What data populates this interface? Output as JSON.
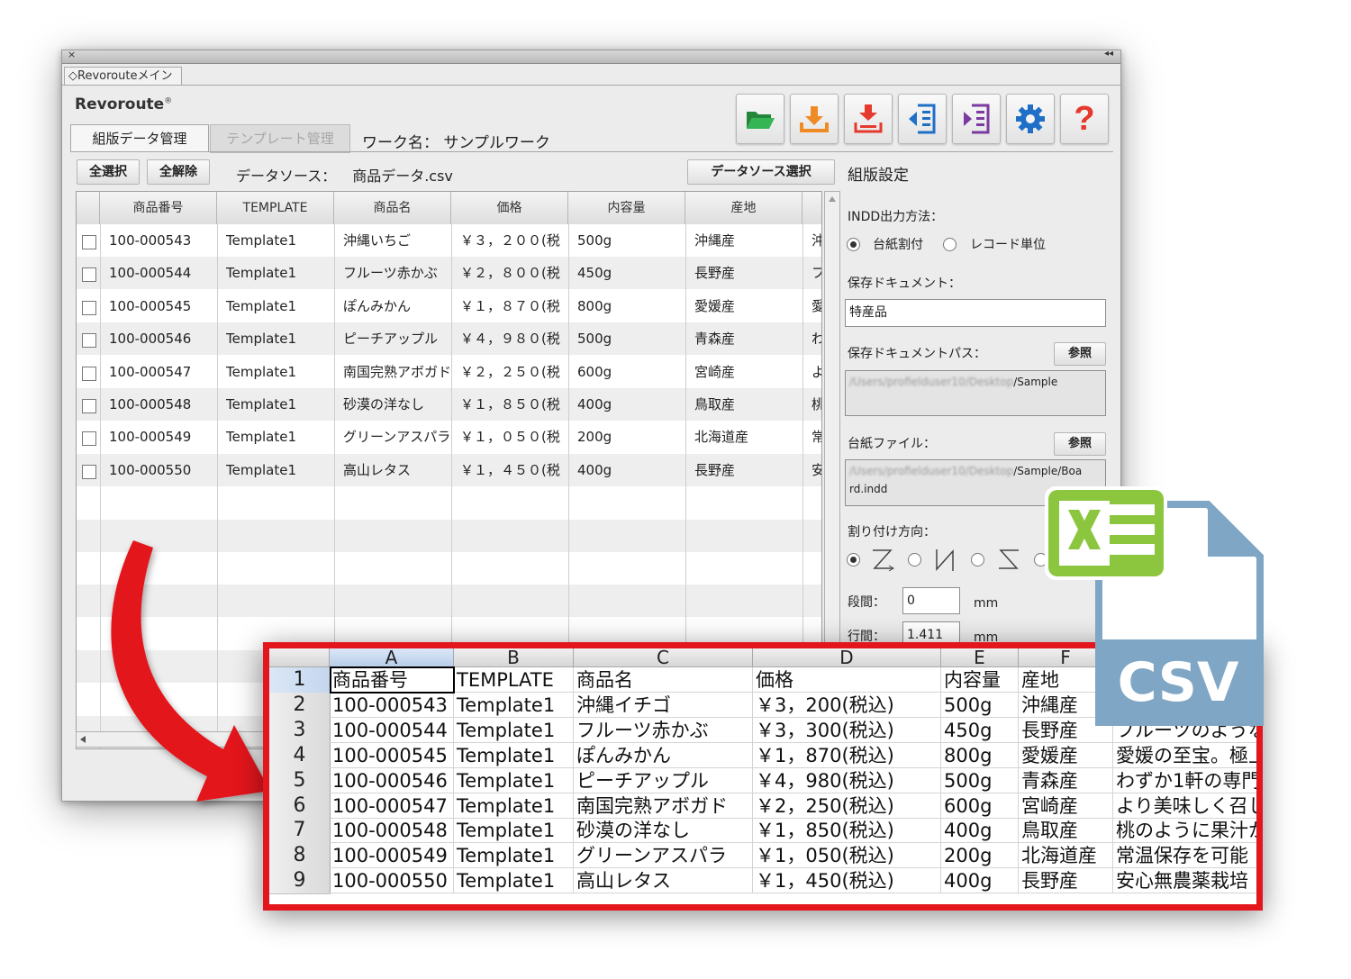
{
  "window": {
    "close_glyph": "×",
    "collapse_glyph": "◂◂",
    "panel_tab": "◇Revorouteメイン",
    "brand": "Revoroute",
    "brand_mark": "®"
  },
  "toolbar": {
    "icons": [
      "open-folder-icon",
      "import-icon",
      "export-icon",
      "indesign-export-icon",
      "indesign-import-icon",
      "gear-icon",
      "help-icon"
    ],
    "help_glyph": "?",
    "colors": {
      "green": "#2f9e44",
      "orange": "#f08a24",
      "blue": "#1f6fc7",
      "purple": "#7b3aa0",
      "red": "#e6392e"
    }
  },
  "tabs": {
    "active": "組版データ管理",
    "inactive": "テンプレート管理"
  },
  "workname": "ワーク名： サンプルワーク",
  "datasource": {
    "select_all": "全選択",
    "deselect_all": "全解除",
    "label": "データソース：",
    "value": "商品データ.csv",
    "select_button": "データソース選択"
  },
  "grid": {
    "columns": [
      "商品番号",
      "TEMPLATE",
      "商品名",
      "価格",
      "内容量",
      "産地"
    ],
    "rows": [
      [
        "100-000543",
        "Template1",
        "沖縄いちご",
        "￥３，２００(税",
        "500g",
        "沖縄産",
        "沖"
      ],
      [
        "100-000544",
        "Template1",
        "フルーツ赤かぶ",
        "￥２，８００(税",
        "450g",
        "長野産",
        "フ"
      ],
      [
        "100-000545",
        "Template1",
        "ぽんみかん",
        "￥１，８７０(税",
        "800g",
        "愛媛産",
        "愛"
      ],
      [
        "100-000546",
        "Template1",
        "ピーチアップル",
        "￥４，９８０(税",
        "500g",
        "青森産",
        "わ"
      ],
      [
        "100-000547",
        "Template1",
        "南国完熟アボガド",
        "￥２，２５０(税",
        "600g",
        "宮崎産",
        "よ"
      ],
      [
        "100-000548",
        "Template1",
        "砂漠の洋なし",
        "￥１，８５０(税",
        "400g",
        "鳥取産",
        "桃"
      ],
      [
        "100-000549",
        "Template1",
        "グリーンアスパラ",
        "￥１，０５０(税",
        "200g",
        "北海道産",
        "常"
      ],
      [
        "100-000550",
        "Template1",
        "高山レタス",
        "￥１，４５０(税",
        "400g",
        "長野産",
        "安"
      ]
    ]
  },
  "settings": {
    "title": "組版設定",
    "indd_output_label": "INDD出力方法：",
    "option_board": "台紙割付",
    "option_record": "レコード単位",
    "save_doc_label": "保存ドキュメント：",
    "save_doc_value": "特産品",
    "save_path_label": "保存ドキュメントパス：",
    "browse": "参照",
    "save_path_blurred": "/Users/profielduser10/Desktop",
    "save_path_suffix": "/Sample",
    "board_file_label": "台紙ファイル：",
    "board_path_blurred": "/Users/profielduser10/Desktop",
    "board_path_suffix": "/Sample/Boa",
    "board_path_line2": "rd.indd",
    "direction_label": "割り付け方向：",
    "dan_label": "段間：",
    "dan_value": "0",
    "gyo_label": "行間：",
    "gyo_value": "1.411",
    "unit": "mm"
  },
  "spreadsheet": {
    "col_letters": [
      "A",
      "B",
      "C",
      "D",
      "E",
      "F"
    ],
    "row_numbers": [
      "1",
      "2",
      "3",
      "4",
      "5",
      "6",
      "7",
      "8",
      "9"
    ],
    "rows": [
      [
        "商品番号",
        "TEMPLATE",
        "商品名",
        "価格",
        "内容量",
        "産地",
        ""
      ],
      [
        "100-000543",
        "Template1",
        "沖縄イチゴ",
        "￥3，200(税込)",
        "500g",
        "沖縄産",
        ""
      ],
      [
        "100-000544",
        "Template1",
        "フルーツ赤かぶ",
        "￥3，300(税込)",
        "450g",
        "長野産",
        "フルーツのような"
      ],
      [
        "100-000545",
        "Template1",
        "ぽんみかん",
        "￥1，870(税込)",
        "800g",
        "愛媛産",
        "愛媛の至宝。極上"
      ],
      [
        "100-000546",
        "Template1",
        "ピーチアップル",
        "￥4，980(税込)",
        "500g",
        "青森産",
        "わずか1軒の専門"
      ],
      [
        "100-000547",
        "Template1",
        "南国完熟アボガド",
        "￥2，250(税込)",
        "600g",
        "宮崎産",
        "より美味しく召し"
      ],
      [
        "100-000548",
        "Template1",
        "砂漠の洋なし",
        "￥1，850(税込)",
        "400g",
        "鳥取産",
        "桃のように果汁か"
      ],
      [
        "100-000549",
        "Template1",
        "グリーンアスパラ",
        "￥1，050(税込)",
        "200g",
        "北海道産",
        "常温保存を可能"
      ],
      [
        "100-000550",
        "Template1",
        "高山レタス",
        "￥1，450(税込)",
        "400g",
        "長野産",
        "安心無農薬栽培"
      ]
    ]
  },
  "csv_icon": {
    "label": "CSV",
    "excel_color": "#8cc63f",
    "file_color": "#7fa6c5"
  },
  "accent": {
    "red": "#e3161e"
  }
}
